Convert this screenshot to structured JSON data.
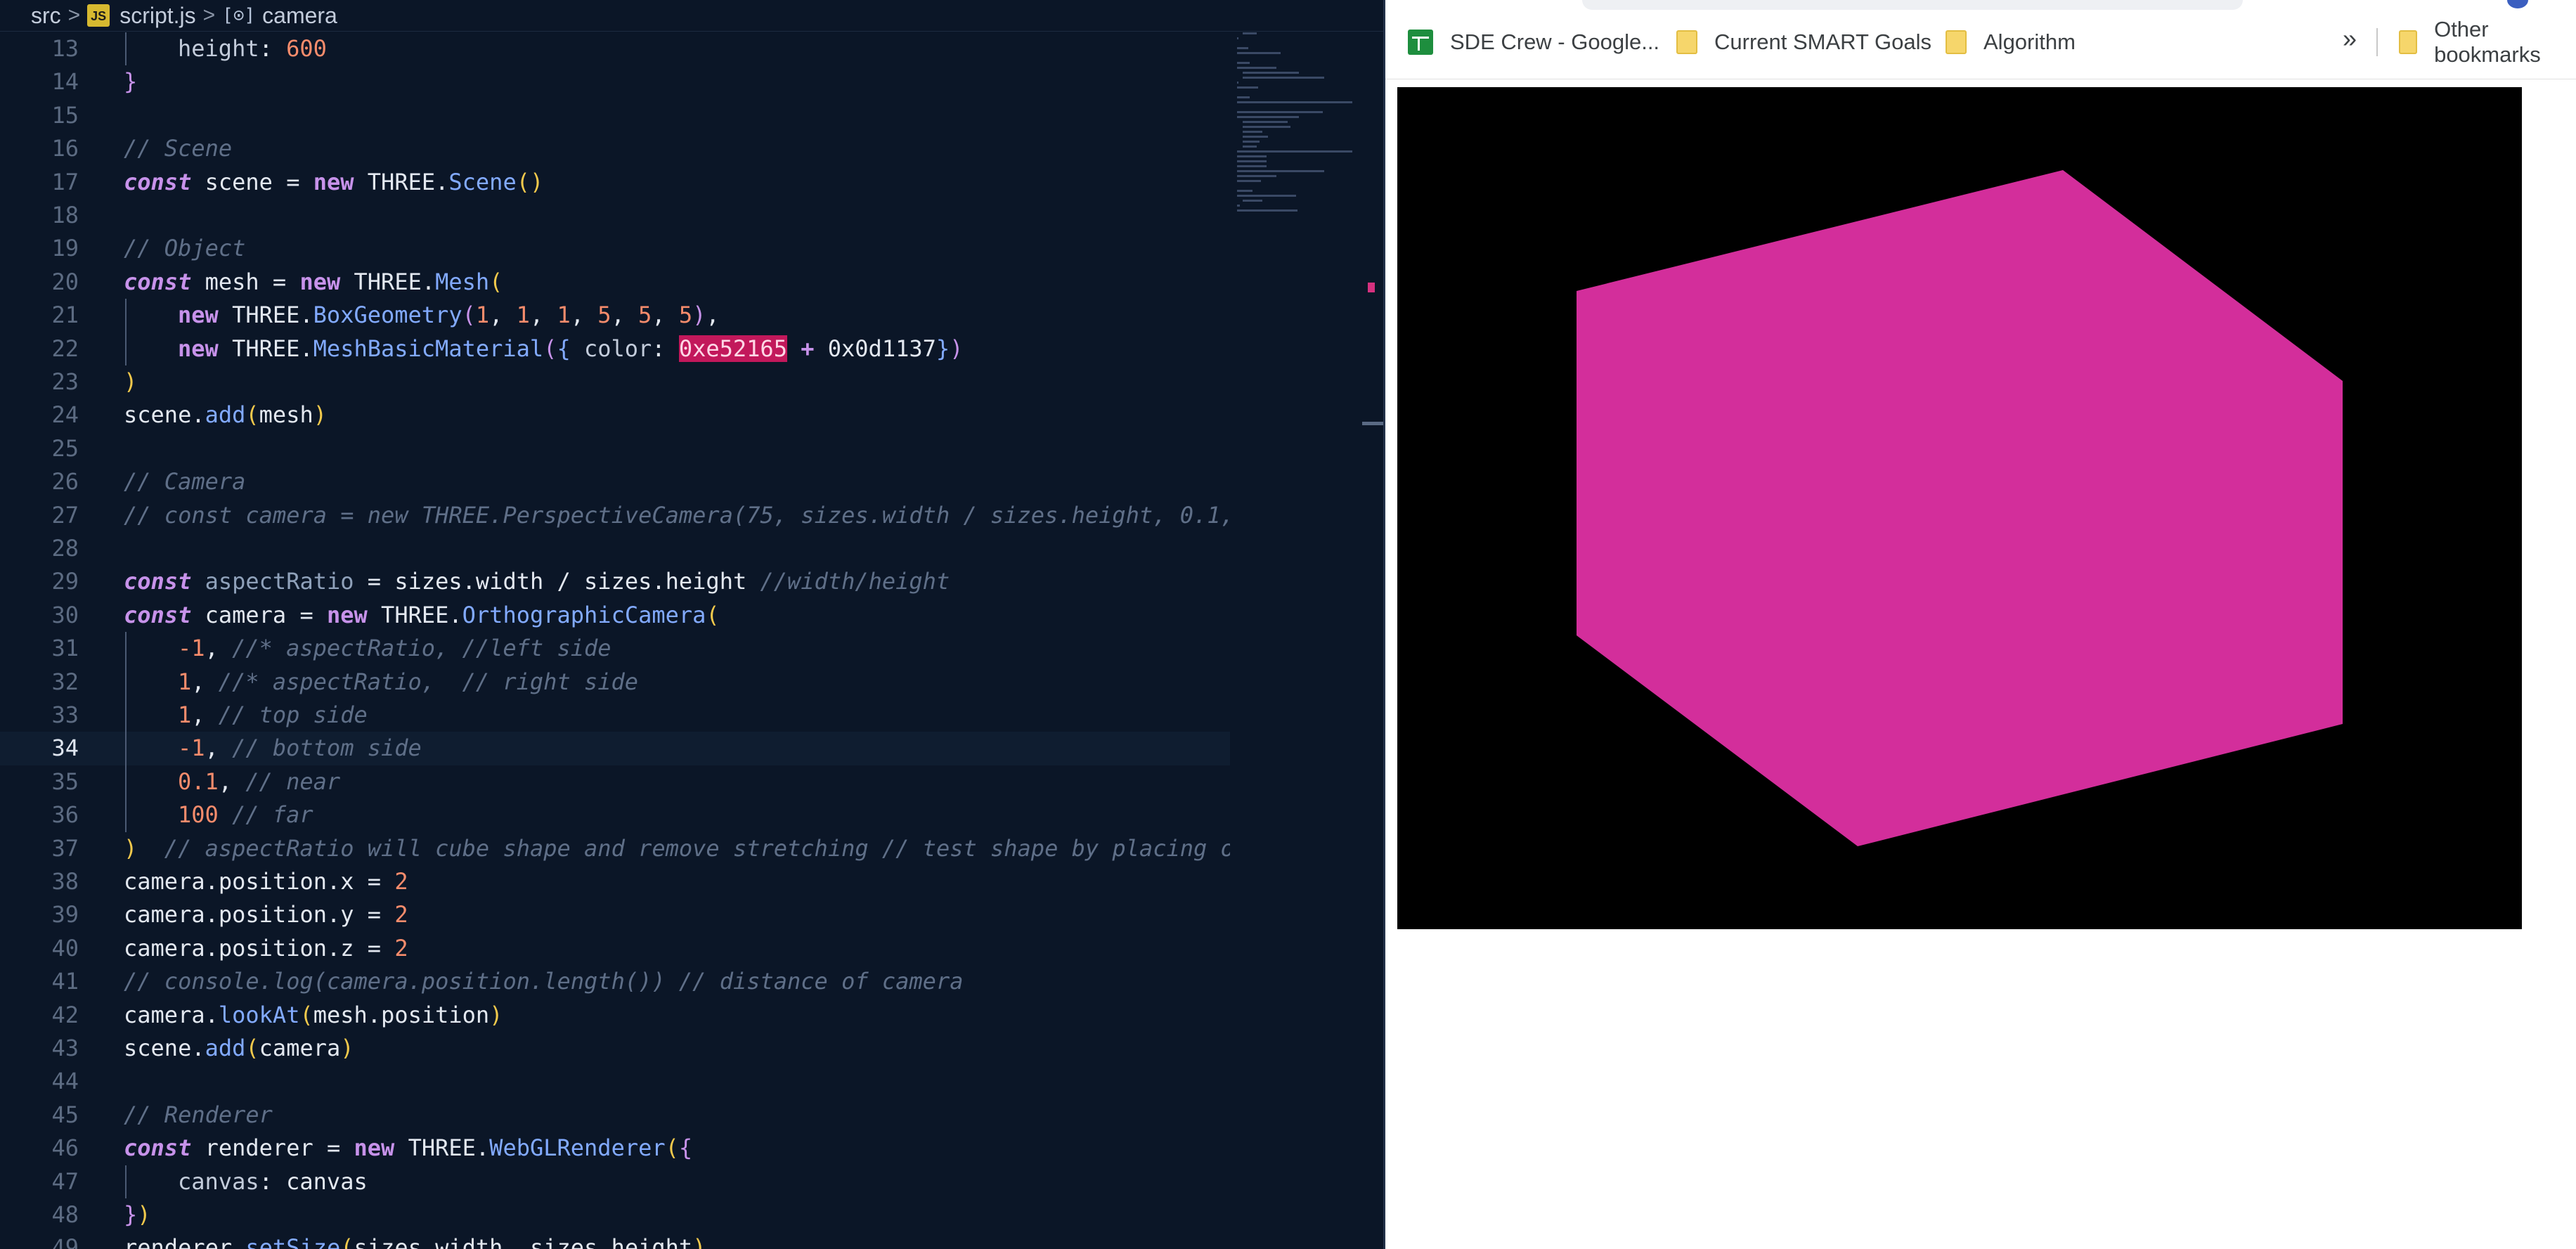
{
  "breadcrumb": {
    "folder": "src",
    "file": "script.js",
    "file_icon": "JS",
    "symbol": "camera"
  },
  "lines": [
    {
      "n": "13",
      "indent": 1,
      "tokens": [
        [
          "tok-prop",
          "height"
        ],
        [
          "",
          "："
        ],
        [
          "tok-num",
          "600"
        ]
      ]
    },
    {
      "n": "14",
      "indent": 0,
      "tokens": [
        [
          "tok-br2",
          "}"
        ]
      ]
    },
    {
      "n": "15",
      "indent": 0,
      "tokens": []
    },
    {
      "n": "16",
      "indent": 0,
      "tokens": [
        [
          "tok-cm",
          "// Scene"
        ]
      ]
    },
    {
      "n": "17",
      "indent": 0,
      "tokens": [
        [
          "tok-kw",
          "const"
        ],
        [
          "",
          " scene = "
        ],
        [
          "tok-new",
          "new"
        ],
        [
          "",
          " THREE."
        ],
        [
          "tok-fn",
          "Scene"
        ],
        [
          "tok-br",
          "()"
        ]
      ]
    },
    {
      "n": "18",
      "indent": 0,
      "tokens": []
    },
    {
      "n": "19",
      "indent": 0,
      "tokens": [
        [
          "tok-cm",
          "// Object"
        ]
      ]
    },
    {
      "n": "20",
      "indent": 0,
      "tokens": [
        [
          "tok-kw",
          "const"
        ],
        [
          "",
          " mesh = "
        ],
        [
          "tok-new",
          "new"
        ],
        [
          "",
          " THREE."
        ],
        [
          "tok-fn",
          "Mesh"
        ],
        [
          "tok-br",
          "("
        ]
      ]
    },
    {
      "n": "21",
      "indent": 1,
      "tokens": [
        [
          "tok-new",
          "new"
        ],
        [
          "",
          " THREE."
        ],
        [
          "tok-fn",
          "BoxGeometry"
        ],
        [
          "tok-br2",
          "("
        ],
        [
          "tok-num",
          "1"
        ],
        [
          "",
          ", "
        ],
        [
          "tok-num",
          "1"
        ],
        [
          "",
          ", "
        ],
        [
          "tok-num",
          "1"
        ],
        [
          "",
          ", "
        ],
        [
          "tok-num",
          "5"
        ],
        [
          "",
          ", "
        ],
        [
          "tok-num",
          "5"
        ],
        [
          "",
          ", "
        ],
        [
          "tok-num",
          "5"
        ],
        [
          "tok-br2",
          ")"
        ],
        [
          "",
          ","
        ]
      ]
    },
    {
      "n": "22",
      "indent": 1,
      "tokens": [
        [
          "tok-new",
          "new"
        ],
        [
          "",
          " THREE."
        ],
        [
          "tok-fn",
          "MeshBasicMaterial"
        ],
        [
          "tok-br2",
          "("
        ],
        [
          "tok-fn",
          "{"
        ],
        [
          "tok-prop",
          " color"
        ],
        [
          "",
          ": "
        ],
        [
          "tok-hl",
          "0xe52165"
        ],
        [
          "",
          " "
        ],
        [
          "tok-kw",
          "+"
        ],
        [
          "",
          " 0x0d1137"
        ],
        [
          "tok-fn",
          "}"
        ],
        [
          "tok-br2",
          ")"
        ]
      ]
    },
    {
      "n": "23",
      "indent": 0,
      "tokens": [
        [
          "tok-br",
          ")"
        ]
      ]
    },
    {
      "n": "24",
      "indent": 0,
      "tokens": [
        [
          "",
          "scene."
        ],
        [
          "tok-fn",
          "add"
        ],
        [
          "tok-br",
          "("
        ],
        [
          "",
          "mesh"
        ],
        [
          "tok-br",
          ")"
        ]
      ]
    },
    {
      "n": "25",
      "indent": 0,
      "tokens": []
    },
    {
      "n": "26",
      "indent": 0,
      "tokens": [
        [
          "tok-cm",
          "// Camera"
        ]
      ]
    },
    {
      "n": "27",
      "indent": 0,
      "tokens": [
        [
          "tok-cm",
          "// const camera = new THREE.PerspectiveCamera(75, sizes.width / sizes.height, 0.1,"
        ]
      ]
    },
    {
      "n": "28",
      "indent": 0,
      "tokens": []
    },
    {
      "n": "29",
      "indent": 0,
      "tokens": [
        [
          "tok-kw",
          "const"
        ],
        [
          "tok-ph",
          " aspectRatio"
        ],
        [
          "",
          " = sizes.width / sizes.height "
        ],
        [
          "tok-cm",
          "//width/height"
        ]
      ]
    },
    {
      "n": "30",
      "indent": 0,
      "tokens": [
        [
          "tok-kw",
          "const"
        ],
        [
          "",
          " camera = "
        ],
        [
          "tok-new",
          "new"
        ],
        [
          "",
          " THREE."
        ],
        [
          "tok-fn",
          "OrthographicCamera"
        ],
        [
          "tok-br",
          "("
        ]
      ]
    },
    {
      "n": "31",
      "indent": 1,
      "tokens": [
        [
          "tok-num",
          "-1"
        ],
        [
          "",
          ", "
        ],
        [
          "tok-cm",
          "//* aspectRatio, //left side"
        ]
      ]
    },
    {
      "n": "32",
      "indent": 1,
      "tokens": [
        [
          "tok-num",
          "1"
        ],
        [
          "",
          ", "
        ],
        [
          "tok-cm",
          "//* aspectRatio,  // right side"
        ]
      ]
    },
    {
      "n": "33",
      "indent": 1,
      "tokens": [
        [
          "tok-num",
          "1"
        ],
        [
          "",
          ", "
        ],
        [
          "tok-cm",
          "// top side"
        ]
      ]
    },
    {
      "n": "34",
      "indent": 1,
      "current": true,
      "tokens": [
        [
          "tok-num",
          "-1"
        ],
        [
          "",
          ", "
        ],
        [
          "tok-cm",
          "// bottom side"
        ]
      ]
    },
    {
      "n": "35",
      "indent": 1,
      "tokens": [
        [
          "tok-num",
          "0.1"
        ],
        [
          "",
          ", "
        ],
        [
          "tok-cm",
          "// near"
        ]
      ]
    },
    {
      "n": "36",
      "indent": 1,
      "tokens": [
        [
          "tok-num",
          "100"
        ],
        [
          "",
          " "
        ],
        [
          "tok-cm",
          "// far"
        ]
      ]
    },
    {
      "n": "37",
      "indent": 0,
      "tokens": [
        [
          "tok-br",
          ")"
        ],
        [
          "",
          "  "
        ],
        [
          "tok-cm",
          "// aspectRatio will cube shape and remove stretching // test shape by placing o"
        ]
      ]
    },
    {
      "n": "38",
      "indent": 0,
      "tokens": [
        [
          "",
          "camera.position.x = "
        ],
        [
          "tok-num",
          "2"
        ]
      ]
    },
    {
      "n": "39",
      "indent": 0,
      "tokens": [
        [
          "",
          "camera.position.y = "
        ],
        [
          "tok-num",
          "2"
        ]
      ]
    },
    {
      "n": "40",
      "indent": 0,
      "tokens": [
        [
          "",
          "camera.position.z = "
        ],
        [
          "tok-num",
          "2"
        ]
      ]
    },
    {
      "n": "41",
      "indent": 0,
      "tokens": [
        [
          "tok-cm",
          "// console.log(camera.position.length()) // distance of camera"
        ]
      ]
    },
    {
      "n": "42",
      "indent": 0,
      "tokens": [
        [
          "",
          "camera."
        ],
        [
          "tok-fn",
          "lookAt"
        ],
        [
          "tok-br",
          "("
        ],
        [
          "",
          "mesh.position"
        ],
        [
          "tok-br",
          ")"
        ]
      ]
    },
    {
      "n": "43",
      "indent": 0,
      "tokens": [
        [
          "",
          "scene."
        ],
        [
          "tok-fn",
          "add"
        ],
        [
          "tok-br",
          "("
        ],
        [
          "",
          "camera"
        ],
        [
          "tok-br",
          ")"
        ]
      ]
    },
    {
      "n": "44",
      "indent": 0,
      "tokens": []
    },
    {
      "n": "45",
      "indent": 0,
      "tokens": [
        [
          "tok-cm",
          "// Renderer"
        ]
      ]
    },
    {
      "n": "46",
      "indent": 0,
      "tokens": [
        [
          "tok-kw",
          "const"
        ],
        [
          "",
          " renderer = "
        ],
        [
          "tok-new",
          "new"
        ],
        [
          "",
          " THREE."
        ],
        [
          "tok-fn",
          "WebGLRenderer"
        ],
        [
          "tok-br",
          "("
        ],
        [
          "tok-br2",
          "{"
        ]
      ]
    },
    {
      "n": "47",
      "indent": 1,
      "tokens": [
        [
          "tok-prop",
          "canvas"
        ],
        [
          "",
          ": canvas"
        ]
      ]
    },
    {
      "n": "48",
      "indent": 0,
      "tokens": [
        [
          "tok-br2",
          "}"
        ],
        [
          "tok-br",
          ")"
        ]
      ]
    },
    {
      "n": "49",
      "indent": 0,
      "tokens": [
        [
          "",
          "renderer."
        ],
        [
          "tok-fn",
          "setSize"
        ],
        [
          "tok-br",
          "("
        ],
        [
          "",
          "sizes.width, sizes.height"
        ],
        [
          "tok-br",
          ")"
        ]
      ]
    }
  ],
  "bookmarks": [
    {
      "label": "SDE Crew - Google...",
      "icon": "sheets-icon"
    },
    {
      "label": "Current SMART Goals",
      "icon": "folder-icon"
    },
    {
      "label": "Algorithm",
      "icon": "folder-icon"
    }
  ],
  "bookmarks_overflow": "»",
  "other_bookmarks": "Other bookmarks",
  "scene": {
    "background": "#000000",
    "mesh_color": "#d32e9b",
    "mesh_shape": "cube"
  }
}
